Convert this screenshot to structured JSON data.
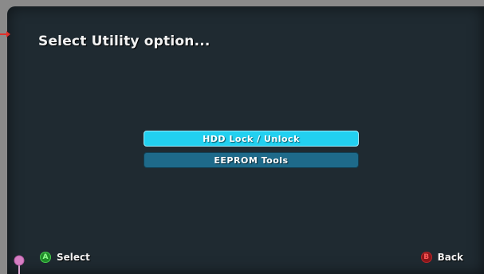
{
  "header": {
    "title": "Select Utility option..."
  },
  "menu": {
    "items": [
      {
        "label": "HDD Lock / Unlock",
        "selected": true
      },
      {
        "label": "EEPROM Tools",
        "selected": false
      }
    ]
  },
  "footer": {
    "select": {
      "button": "A",
      "label": "Select"
    },
    "back": {
      "button": "B",
      "label": "Back"
    }
  },
  "colors": {
    "background": "#1f2a31",
    "selected_item": "#22d0f0",
    "normal_item": "#1e6a8a",
    "button_a": "#1f8a28",
    "button_b": "#8a1518"
  },
  "icons": {
    "pointer": "arrow-marker-icon",
    "pin": "pin-marker-icon"
  }
}
